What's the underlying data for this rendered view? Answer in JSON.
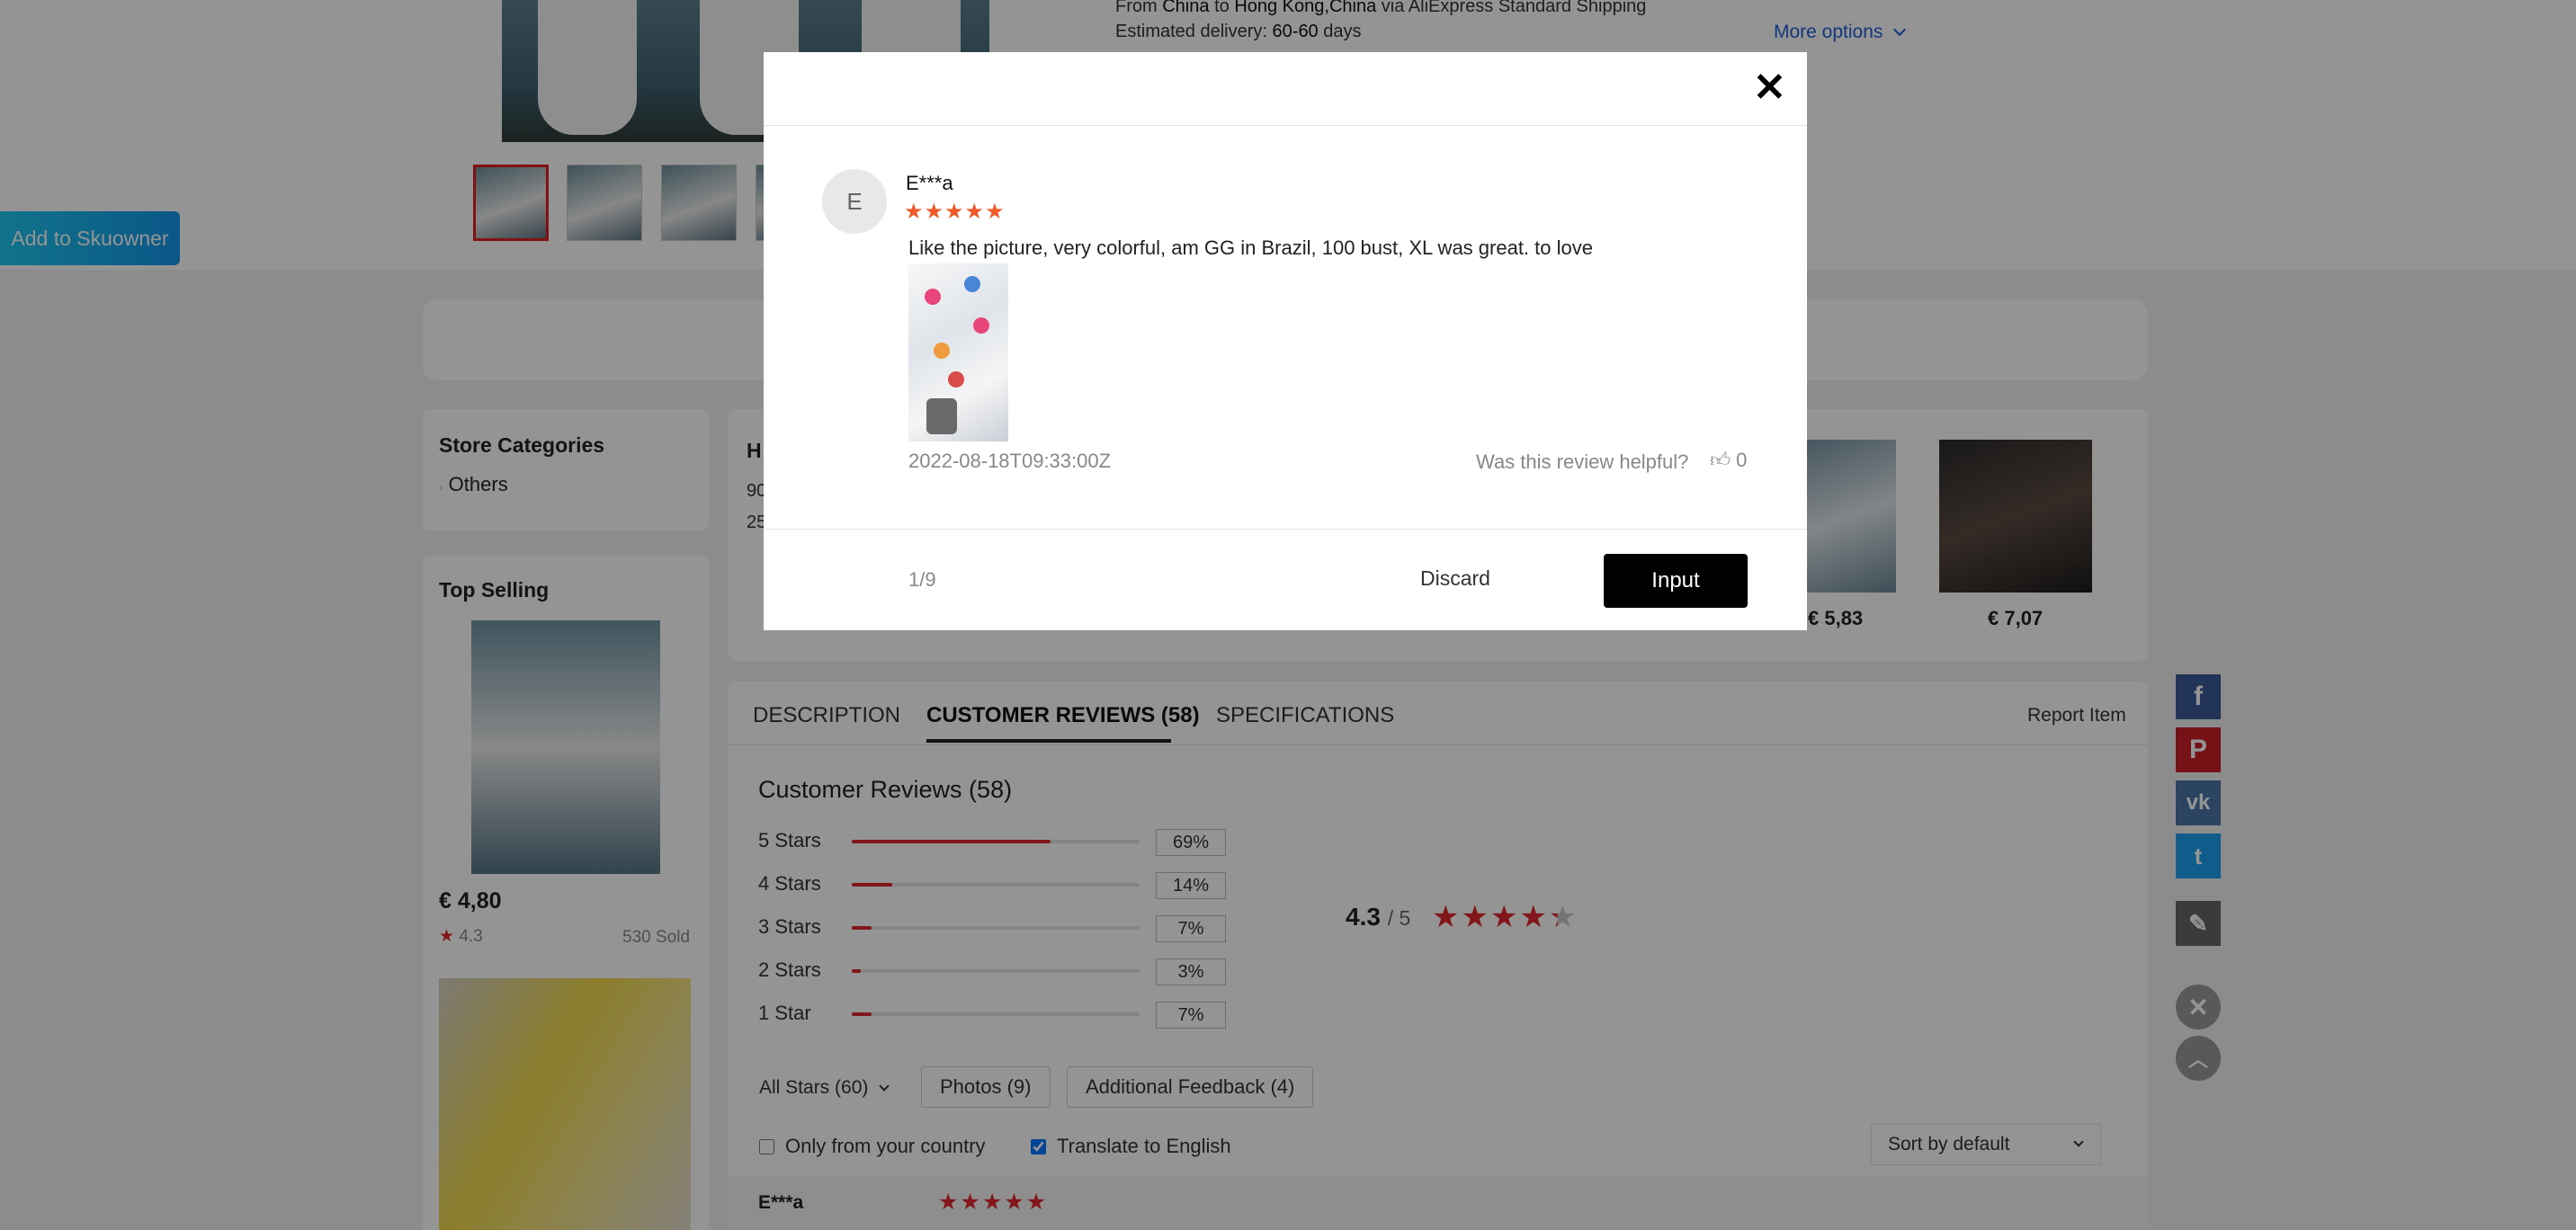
{
  "shipping": {
    "line1_pre": "From",
    "origin": "China",
    "line1_mid": "to",
    "destination": "Hong Kong,China",
    "line1_post": "via AliExpress Standard Shipping",
    "delivery_label": "Estimated delivery:",
    "delivery_value": "60-60",
    "delivery_unit": "days",
    "more_options": "More options"
  },
  "skuowner_button": "Add to Skuowner",
  "store_categories": {
    "title": "Store Categories",
    "items": [
      "Others"
    ]
  },
  "top_selling": {
    "title": "Top Selling",
    "products": [
      {
        "price": "€ 4,80",
        "rating": "4.3",
        "sold": "530 Sold"
      }
    ]
  },
  "store_info": {
    "heading_initial": "H",
    "line1": "90",
    "line2": "25",
    "prices": [
      "€ 5,83",
      "€ 7,07"
    ]
  },
  "tabs": {
    "description": "DESCRIPTION",
    "reviews": "CUSTOMER REVIEWS (58)",
    "specifications": "SPECIFICATIONS",
    "report": "Report Item"
  },
  "reviews_summary": {
    "title": "Customer Reviews (58)",
    "rows": [
      {
        "label": "5 Stars",
        "percent": "69%",
        "value": 0.69
      },
      {
        "label": "4 Stars",
        "percent": "14%",
        "value": 0.14
      },
      {
        "label": "3 Stars",
        "percent": "7%",
        "value": 0.07
      },
      {
        "label": "2 Stars",
        "percent": "3%",
        "value": 0.03
      },
      {
        "label": "1 Star",
        "percent": "7%",
        "value": 0.07
      }
    ],
    "average": "4.3",
    "out_of": "/ 5",
    "average_value": 4.3
  },
  "filters": {
    "all_stars": "All Stars (60)",
    "photos": "Photos (9)",
    "additional": "Additional Feedback (4)",
    "only_country": "Only from your country",
    "only_country_checked": false,
    "translate": "Translate to English",
    "translate_checked": true,
    "sort": "Sort by default"
  },
  "first_review": {
    "user": "E***a",
    "stars": 5
  },
  "modal": {
    "avatar_initial": "E",
    "username": "E***a",
    "stars": 5,
    "text": "Like the picture, very colorful, am GG in Brazil, 100 bust, XL was great. to love",
    "date": "2022-08-18T09:33:00Z",
    "helpful_label": "Was this review helpful?",
    "helpful_count": "0",
    "pagination": "1/9",
    "discard": "Discard",
    "input": "Input"
  },
  "colors": {
    "accent_red": "#e0272d",
    "link_blue": "#1f5fd6",
    "facebook": "#3b5998",
    "pinterest": "#cb2027",
    "vk": "#4a76a8",
    "twitter": "#1da1f2",
    "star_orange": "#f05a28"
  },
  "icons": [
    "close-icon",
    "thumbs-up-icon",
    "chevron-down-icon",
    "facebook-icon",
    "pinterest-icon",
    "vk-icon",
    "twitter-icon",
    "edit-pencil-icon",
    "circle-close-icon",
    "scroll-top-icon"
  ]
}
